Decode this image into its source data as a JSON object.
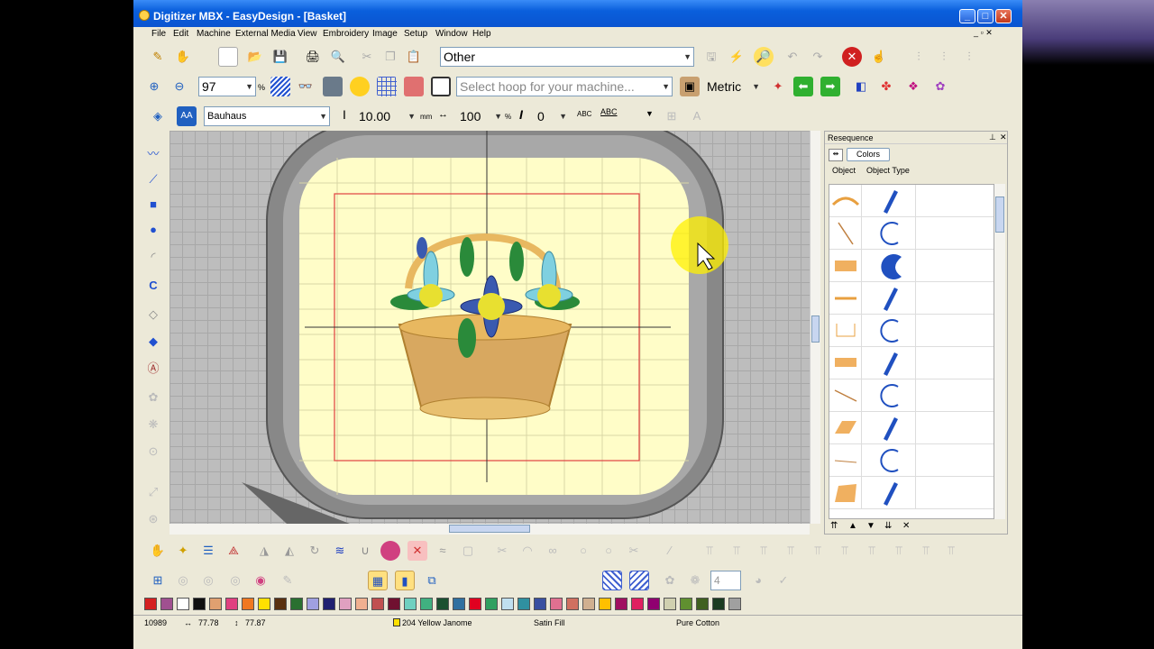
{
  "window": {
    "title": "Digitizer MBX - EasyDesign - [Basket]"
  },
  "menu": [
    "File",
    "Edit",
    "Machine",
    "External Media",
    "View",
    "Embroidery",
    "Image",
    "Setup",
    "Window",
    "Help"
  ],
  "toolbar1": {
    "category_value": "Other"
  },
  "toolbar2": {
    "zoom_value": "97",
    "zoom_unit": "%",
    "hoop_placeholder": "Select hoop for your machine...",
    "units_value": "Metric"
  },
  "toolbar3": {
    "font_value": "Bauhaus",
    "height_value": "10.00",
    "height_unit": "mm",
    "width_value": "100",
    "width_unit": "%",
    "slant_value": "0",
    "spacing_value": "ABC"
  },
  "resequence": {
    "title": "Resequence",
    "colors_button": "Colors",
    "col_object": "Object",
    "col_type": "Object Type"
  },
  "bottom": {
    "count_value": "4"
  },
  "palette": [
    "#d42020",
    "#a05090",
    "#ffffff",
    "#101010",
    "#e0a070",
    "#e04080",
    "#f07820",
    "#ffe000",
    "#5a3010",
    "#2a7030",
    "#a0a0e0",
    "#202070",
    "#e0a0c0",
    "#f0b090",
    "#c05050",
    "#701030",
    "#70d0c0",
    "#40b080",
    "#1a5030",
    "#3070a0",
    "#e00020",
    "#30a060",
    "#c0e0f0",
    "#3090a0",
    "#3a50a0",
    "#e07090",
    "#d07060",
    "#d0b090",
    "#ffc000",
    "#a01060",
    "#e02060",
    "#900070",
    "#d0d0b0",
    "#609030",
    "#406020",
    "#1a3a20",
    "#a0a0a0"
  ],
  "status": {
    "stitches": "10989",
    "width": "77.78",
    "height": "77.87",
    "thread": "204 Yellow Janome",
    "fill": "Satin Fill",
    "fabric": "Pure Cotton"
  }
}
